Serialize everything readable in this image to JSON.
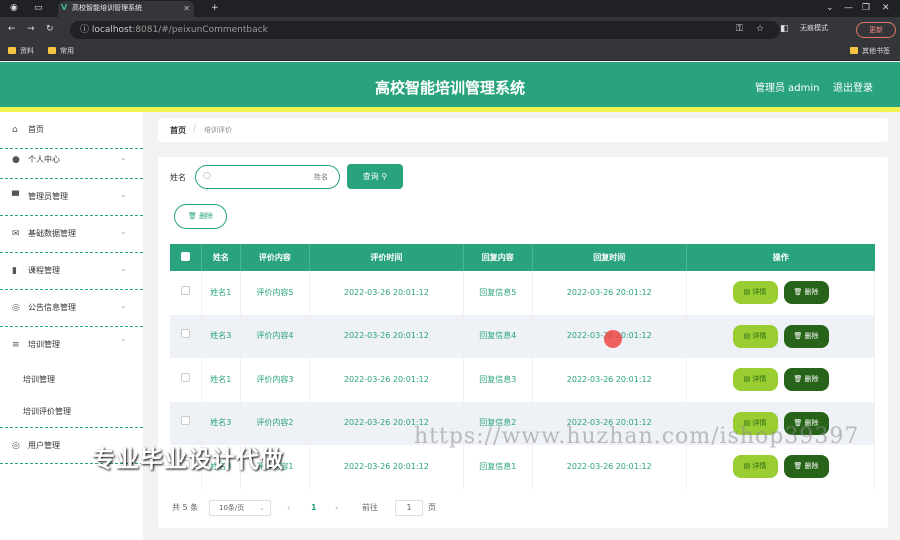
{
  "browser": {
    "tab_title": "高校智能培训管理系统",
    "tab_logo": "V",
    "url_host": "localhost",
    "url_rest": ":8081/#/peixunCommentback",
    "incognito_label": "无痕模式",
    "update_label": "更新",
    "bookmarks": [
      "资料",
      "常用"
    ],
    "bookmark_right": "其他书签"
  },
  "header": {
    "title": "高校智能培训管理系统",
    "admin": "管理员 admin",
    "logout": "退出登录"
  },
  "sidebar": {
    "items": [
      {
        "label": "首页"
      },
      {
        "label": "个人中心"
      },
      {
        "label": "管理员管理"
      },
      {
        "label": "基础数据管理"
      },
      {
        "label": "课程管理"
      },
      {
        "label": "公告信息管理"
      },
      {
        "label": "培训管理"
      },
      {
        "label": "用户管理"
      }
    ],
    "sub": [
      "培训管理",
      "培训评价管理"
    ]
  },
  "breadcrumb": {
    "home": "首页",
    "sep": "/",
    "current": "培训评价"
  },
  "filter": {
    "label": "姓名",
    "placeholder": "姓名",
    "query_label": "查询",
    "delete_label": "删除"
  },
  "table": {
    "headers": [
      "姓名",
      "评价内容",
      "评价时间",
      "回复内容",
      "回复时间",
      "操作"
    ],
    "detail_label": "详情",
    "remove_label": "删除",
    "rows": [
      {
        "name": "姓名1",
        "content": "评价内容5",
        "time": "2022-03-26 20:01:12",
        "reply": "回复信息5",
        "reply_time": "2022-03-26 20:01:12"
      },
      {
        "name": "姓名3",
        "content": "评价内容4",
        "time": "2022-03-26 20:01:12",
        "reply": "回复信息4",
        "reply_time": "2022-03-26 20:01:12"
      },
      {
        "name": "姓名1",
        "content": "评价内容3",
        "time": "2022-03-26 20:01:12",
        "reply": "回复信息3",
        "reply_time": "2022-03-26 20:01:12"
      },
      {
        "name": "姓名3",
        "content": "评价内容2",
        "time": "2022-03-26 20:01:12",
        "reply": "回复信息2",
        "reply_time": "2022-03-26 20:01:12"
      },
      {
        "name": "姓名3",
        "content": "评价内容1",
        "time": "2022-03-26 20:01:12",
        "reply": "回复信息1",
        "reply_time": "2022-03-26 20:01:12"
      }
    ]
  },
  "pager": {
    "total": "共 5 条",
    "page_size": "10条/页",
    "prev": "‹",
    "page": "1",
    "next": "›",
    "goto_label": "前往",
    "goto_value": "1",
    "page_unit": "页"
  },
  "watermark": {
    "cn": "专业毕业设计代做",
    "url": "https://www.huzhan.com/ishop39397"
  },
  "colors": {
    "primary": "#29a37d",
    "accent_line": "#f2f255",
    "detail_btn": "#9acd32",
    "remove_btn": "#27641a"
  }
}
